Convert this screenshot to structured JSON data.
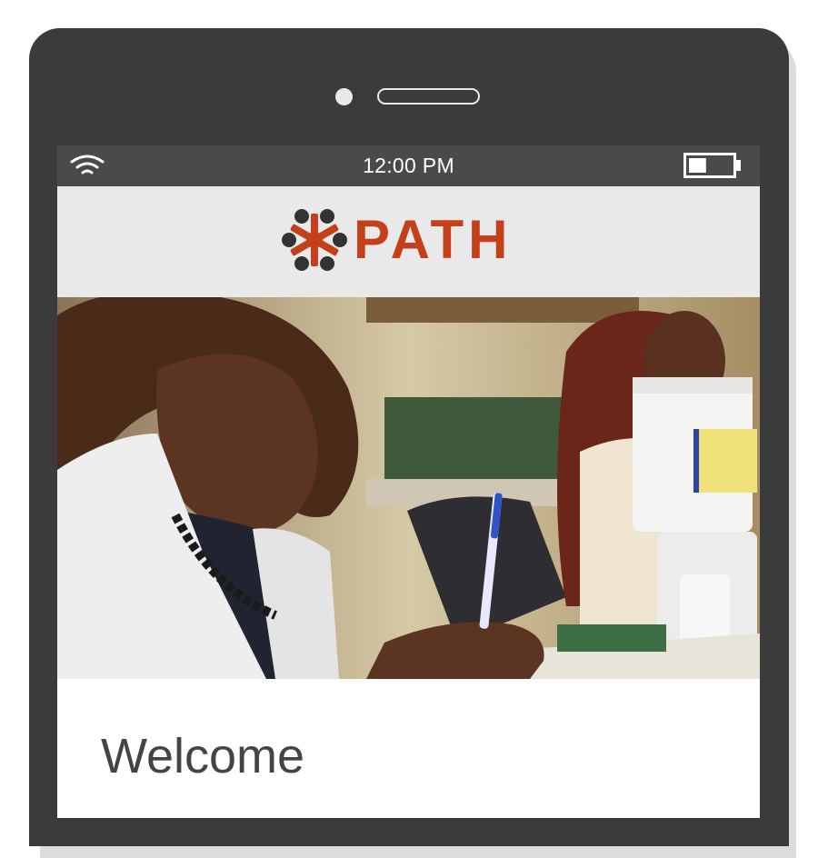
{
  "status_bar": {
    "time": "12:00 PM",
    "wifi_icon": "wifi-icon",
    "battery_icon": "battery-icon",
    "battery_level": 0.4
  },
  "header": {
    "logo_text": "PATH",
    "logo_mark_icon": "path-logo-mark-icon",
    "brand_color": "#c4401b"
  },
  "hero": {
    "image": "photo-pharmacist-writing"
  },
  "main": {
    "title": "Welcome"
  },
  "colors": {
    "device_frame": "#3b3b3b",
    "status_bar": "#4a4a4a",
    "logo_bar": "#e9e9e9",
    "heading_text": "#444444"
  }
}
